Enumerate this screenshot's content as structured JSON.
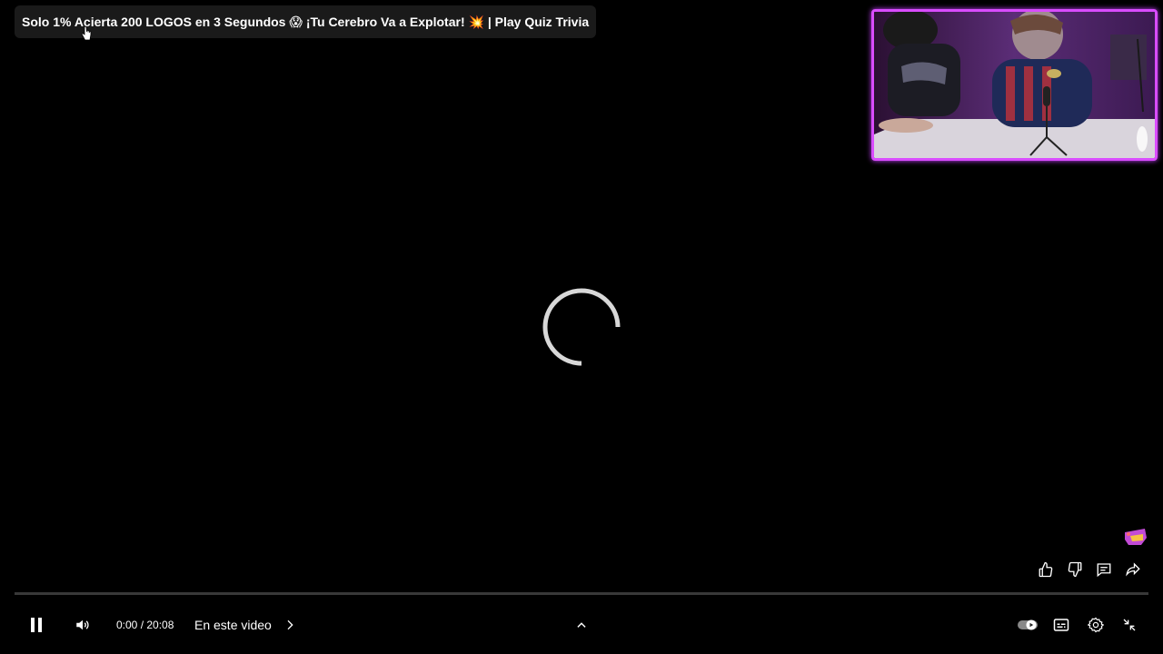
{
  "video": {
    "title": "Solo 1% Acierta 200 LOGOS en 3 Segundos 😱 ¡Tu Cerebro Va a Explotar! 💥 | Play Quiz Trivia",
    "current_time": "0:00",
    "duration": "20:08",
    "time_display": "0:00 / 20:08",
    "progress": 0,
    "state": "loading"
  },
  "controls": {
    "chapter_label": "En este video",
    "play_pause": "pause-icon",
    "volume": "volume-icon",
    "autoplay": "autoplay-toggle",
    "captions": "captions-icon",
    "settings": "settings-icon",
    "exit_fullscreen": "exit-fullscreen-icon",
    "expand": "chevron-up-icon"
  },
  "side_actions": [
    "like-icon",
    "dislike-icon",
    "comment-icon",
    "share-icon"
  ],
  "colors": {
    "background": "#000000",
    "pip_border": "#d94cff",
    "progress": "#ff0000",
    "title_bg": "#1a1a1a"
  }
}
